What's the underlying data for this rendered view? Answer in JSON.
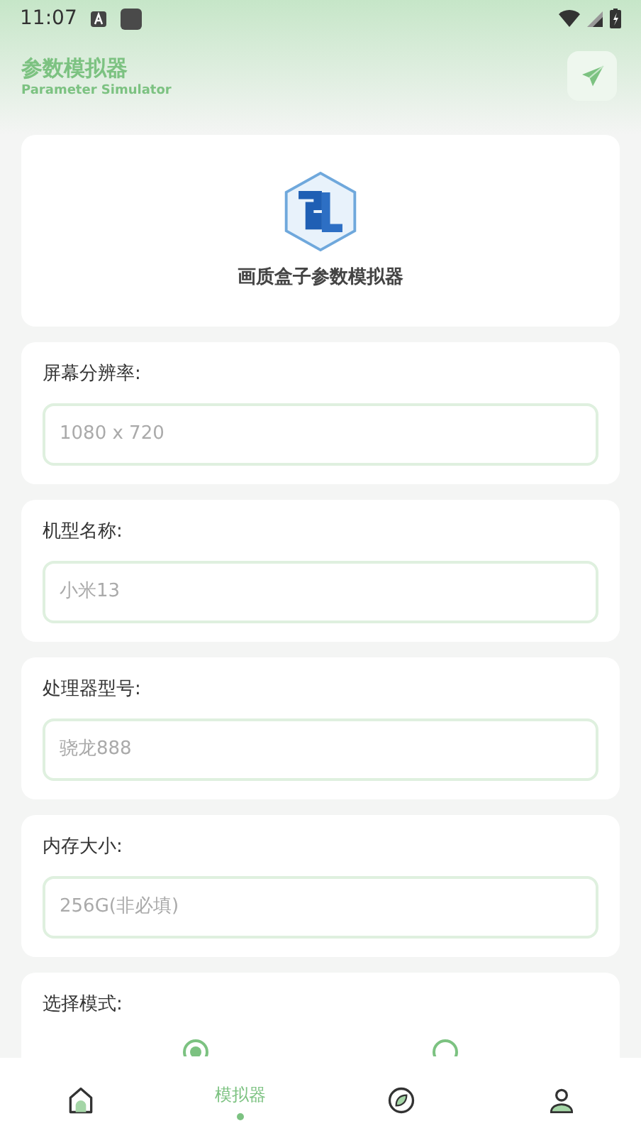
{
  "status_bar": {
    "time": "11:07"
  },
  "header": {
    "title": "参数模拟器",
    "subtitle": "Parameter Simulator"
  },
  "logo_card": {
    "caption": "画质盒子参数模拟器"
  },
  "fields": [
    {
      "label": "屏幕分辨率:",
      "placeholder": "1080 x 720"
    },
    {
      "label": "机型名称:",
      "placeholder": "小米13"
    },
    {
      "label": "处理器型号:",
      "placeholder": "骁龙888"
    },
    {
      "label": "内存大小:",
      "placeholder": "256G(非必填)"
    }
  ],
  "mode": {
    "label": "选择模式:",
    "options": [
      {
        "selected": true
      },
      {
        "selected": false
      }
    ]
  },
  "bottom_nav": [
    {
      "kind": "home",
      "selected": false
    },
    {
      "kind": "text",
      "label": "模拟器",
      "selected": true
    },
    {
      "kind": "compass",
      "selected": false
    },
    {
      "kind": "user",
      "selected": false
    }
  ]
}
